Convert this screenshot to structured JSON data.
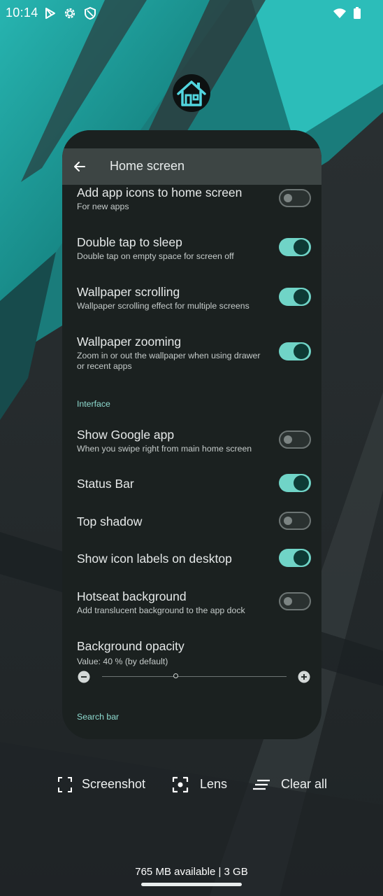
{
  "status_bar": {
    "time": "10:14",
    "icons": [
      "play-store-icon",
      "settings-gear-icon",
      "shield-icon",
      "wifi-icon",
      "battery-icon"
    ]
  },
  "app": {
    "icon": "home-icon"
  },
  "screen": {
    "title": "Home screen",
    "back_icon": "arrow-left-icon",
    "settings": [
      {
        "title": "Add app icons to home screen",
        "subtitle": "For new apps",
        "enabled": false
      },
      {
        "title": "Double tap to sleep",
        "subtitle": "Double tap on empty space for screen off",
        "enabled": true
      },
      {
        "title": "Wallpaper scrolling",
        "subtitle": "Wallpaper scrolling effect for multiple screens",
        "enabled": true
      },
      {
        "title": "Wallpaper zooming",
        "subtitle": "Zoom in or out the wallpaper when using drawer or recent apps",
        "enabled": true
      }
    ],
    "interface_header": "Interface",
    "interface_settings": [
      {
        "title": "Show Google app",
        "subtitle": "When you swipe right from main home screen",
        "enabled": false
      },
      {
        "title": "Status Bar",
        "enabled": true
      },
      {
        "title": "Top shadow",
        "enabled": false
      },
      {
        "title": "Show icon labels on desktop",
        "enabled": true
      },
      {
        "title": "Hotseat background",
        "subtitle": "Add translucent background to the app dock",
        "enabled": false
      }
    ],
    "opacity": {
      "title": "Background opacity",
      "value_text": "Value: 40 % (by default)",
      "value_percent": 40
    },
    "search_bar_header": "Search bar"
  },
  "actions": {
    "screenshot": "Screenshot",
    "lens": "Lens",
    "clear_all": "Clear all"
  },
  "memory": "765 MB available | 3 GB",
  "colors": {
    "accent": "#70d4c7",
    "toggle_knob_on": "#0e3a35",
    "section_header": "#8fdcd1",
    "card_bg": "#1b2120",
    "appbar_bg": "#3d4544",
    "wallpaper_teal": "#1f9e9c"
  }
}
